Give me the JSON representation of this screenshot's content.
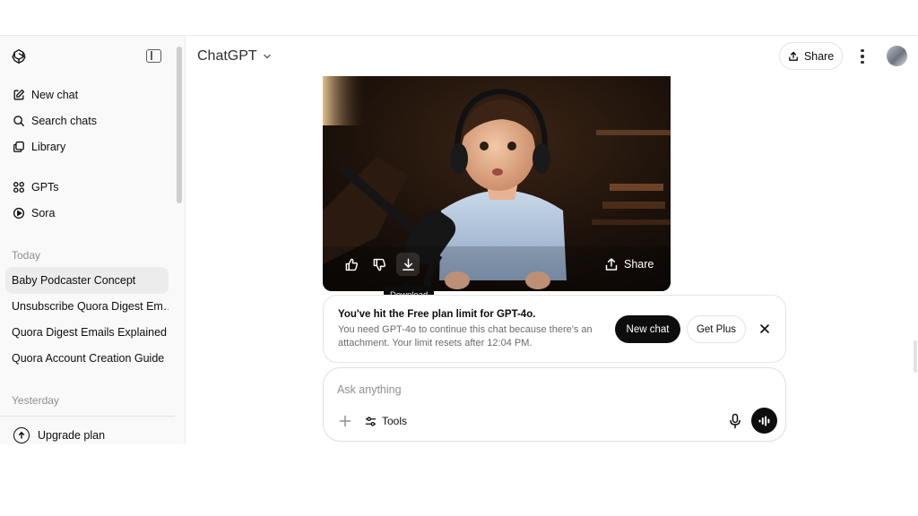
{
  "header": {
    "model_label": "ChatGPT",
    "share_label": "Share"
  },
  "sidebar": {
    "nav": [
      {
        "label": "New chat",
        "icon": "edit-icon"
      },
      {
        "label": "Search chats",
        "icon": "search-icon"
      },
      {
        "label": "Library",
        "icon": "library-icon"
      },
      {
        "label": "GPTs",
        "icon": "grid-icon"
      },
      {
        "label": "Sora",
        "icon": "play-icon"
      }
    ],
    "sections": {
      "today": "Today",
      "yesterday": "Yesterday"
    },
    "chats_today": [
      {
        "label": "Baby Podcaster Concept",
        "active": true
      },
      {
        "label": "Unsubscribe Quora Digest Em…"
      },
      {
        "label": "Quora Digest Emails Explained"
      },
      {
        "label": "Quora Account Creation Guide"
      }
    ],
    "upgrade_label": "Upgrade plan"
  },
  "image_actions": {
    "share_label": "Share",
    "tooltip": "Download"
  },
  "limit_notice": {
    "title": "You've hit the Free plan limit for GPT-4o.",
    "description": "You need GPT-4o to continue this chat because there's an attachment. Your limit resets after 12:04 PM.",
    "new_chat_label": "New chat",
    "get_plus_label": "Get Plus"
  },
  "composer": {
    "placeholder": "Ask anything",
    "tools_label": "Tools"
  },
  "colors": {
    "primary": "#0d0d0d",
    "sidebar_bg": "#f9f9f9",
    "active_chat_bg": "#ececec",
    "muted_text": "#8f8f8f"
  }
}
